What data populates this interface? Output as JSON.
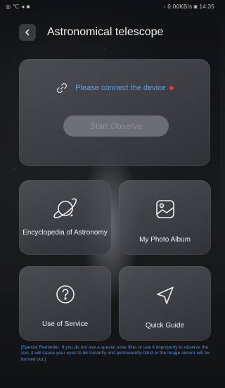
{
  "status_bar": {
    "left": "◎ ℃ ◂ ■",
    "right": "◦ 0.00KB/s ◙ 14:35"
  },
  "header": {
    "title": "Astronomical telescope"
  },
  "connect_card": {
    "message": "Please connect the device",
    "start_button": "Start Observe",
    "colors": {
      "message": "#5fa0e8",
      "alert_dot": "#e53935"
    }
  },
  "tiles": [
    {
      "label": "Encyclopedia of Astronomy",
      "icon": "saturn-icon"
    },
    {
      "label": "My Photo Album",
      "icon": "photo-icon"
    },
    {
      "label": "Use of Service",
      "icon": "help-icon"
    },
    {
      "label": "Quick Guide",
      "icon": "navigation-arrow-icon"
    }
  ],
  "reminder": "[Special Reminder: If you do not use a special solar filter or use it improperly to observe the sun, it will cause your eyes to be instantly and permanently blind or the image sensor will be burned out.]"
}
